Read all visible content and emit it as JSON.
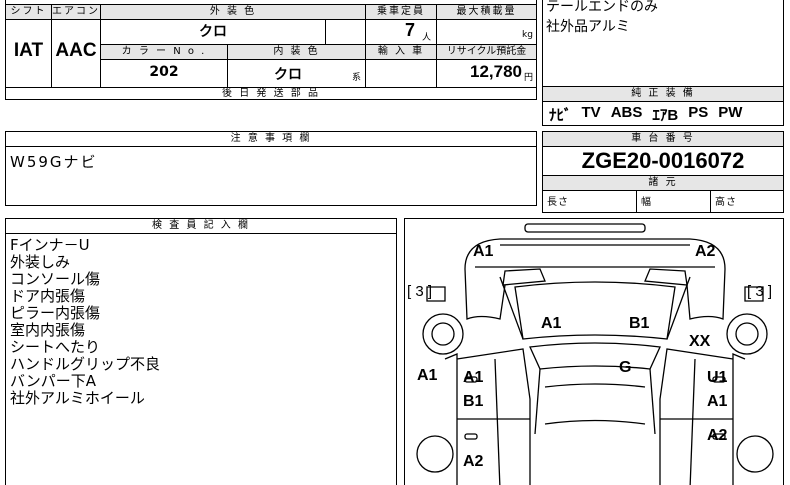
{
  "spec": {
    "shift_header": "シフト",
    "aircon_header": "エアコン",
    "shift_value": "IAT",
    "aircon_value": "AAC",
    "exterior_header": "外 装 色",
    "exterior_value": "クロ",
    "color_no_header": "カ ラ ー N o .",
    "color_no_value": "202",
    "interior_header": "内 装 色",
    "interior_value": "クロ",
    "interior_unit": "系",
    "capacity_header": "乗車定員",
    "capacity_value": "7",
    "capacity_unit": "人",
    "max_load_header": "最大積載量",
    "max_load_unit": "kg",
    "import_header": "輸 入 車",
    "recycle_header": "リサイクル預託金",
    "recycle_value": "12,780",
    "recycle_unit": "円",
    "post_parts_header": "後 日 発 送 部 品"
  },
  "top_right": {
    "lines": [
      "テールエンドのみ",
      "社外品アルミ"
    ]
  },
  "equipment": {
    "header": "純 正 装 備",
    "items": [
      "ﾅﾋﾞ",
      "TV",
      "ABS",
      "ｴｱB",
      "PS",
      "PW"
    ]
  },
  "notes": {
    "header": "注 意 事 項 欄",
    "text": "W59Gナビ"
  },
  "chassis": {
    "header": "車 台 番 号",
    "number": "ZGE20-0016072",
    "specs_header": "諸 元",
    "length_label": "長さ",
    "width_label": "幅",
    "height_label": "高さ"
  },
  "inspector": {
    "header": "検 査 員 記 入 欄",
    "lines": [
      "Fインナ－U",
      "外装しみ",
      "コンソール傷",
      "ドア内張傷",
      "ピラー内張傷",
      "室内内張傷",
      "シートへたり",
      "ハンドルグリップ不良",
      "バンパー下A",
      "社外アルミホイール"
    ]
  },
  "diagram": {
    "marks": {
      "front_left": "A1",
      "front_right": "A2",
      "left_bracket": "[ 3 ]",
      "right_bracket": "[ 3 ]",
      "hood_left": "A1",
      "hood_right": "B1",
      "right_xx": "XX",
      "roof_g": "G",
      "left_side": "A1",
      "left_door_a1": "A1",
      "left_door_b1": "B1",
      "right_u1": "U1",
      "right_a1": "A1",
      "right_a2": "A2",
      "left_rear_a2": "A2"
    }
  }
}
